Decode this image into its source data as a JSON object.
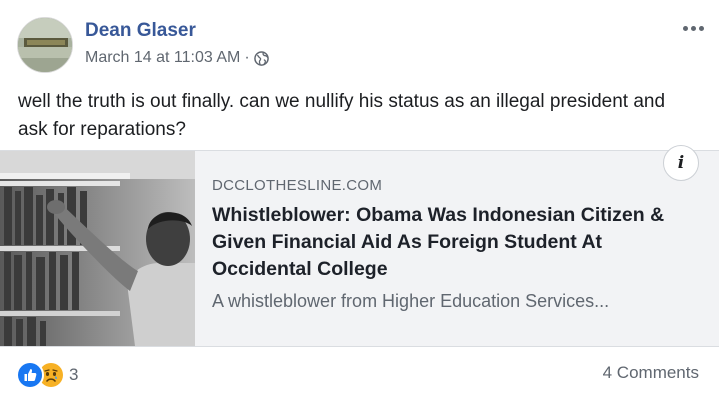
{
  "post": {
    "author": "Dean Glaser",
    "timestamp": "March 14 at 11:03 AM",
    "separator": "·",
    "privacy_icon": "globe-icon",
    "menu_icon": "more-options-icon",
    "message": "well the truth is out finally. can we nullify his status as an illegal president and ask for reparations?"
  },
  "link_card": {
    "domain": "DCCLOTHESLINE.COM",
    "headline": "Whistleblower: Obama Was Indonesian Citizen & Given Financial Aid As Foreign Student At Occidental College",
    "description": "A whistleblower from Higher Education Services...",
    "info_label": "i",
    "thumbnail_icon": "library-photo"
  },
  "footer": {
    "reaction_icons": [
      "like-icon",
      "sad-icon"
    ],
    "reaction_count": "3",
    "comments": "4 Comments"
  },
  "colors": {
    "author_link": "#385898",
    "secondary_text": "#606770",
    "card_bg": "#f2f3f5",
    "like_blue": "#1877f2",
    "sad_yellow": "#f7b125"
  }
}
